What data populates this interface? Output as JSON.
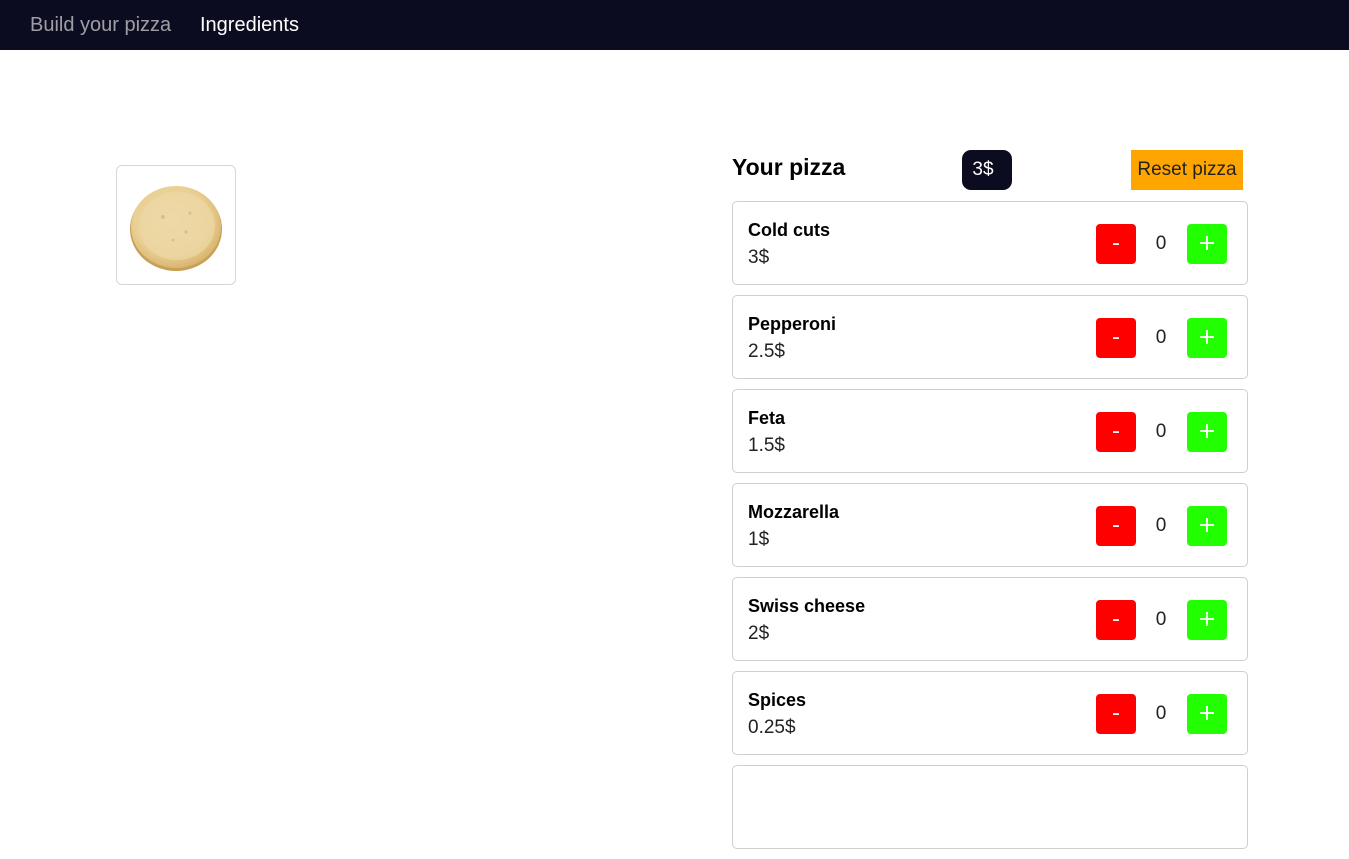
{
  "nav": {
    "items": [
      {
        "label": "Build your pizza"
      },
      {
        "label": "Ingredients"
      }
    ]
  },
  "summary": {
    "title": "Your pizza",
    "total": "3$",
    "reset_label": "Reset pizza"
  },
  "ingredients": [
    {
      "name": "Cold cuts",
      "price": "3$",
      "qty": "0",
      "minus": "-",
      "plus": "+"
    },
    {
      "name": "Pepperoni",
      "price": "2.5$",
      "qty": "0",
      "minus": "-",
      "plus": "+"
    },
    {
      "name": "Feta",
      "price": "1.5$",
      "qty": "0",
      "minus": "-",
      "plus": "+"
    },
    {
      "name": "Mozzarella",
      "price": "1$",
      "qty": "0",
      "minus": "-",
      "plus": "+"
    },
    {
      "name": "Swiss cheese",
      "price": "2$",
      "qty": "0",
      "minus": "-",
      "plus": "+"
    },
    {
      "name": "Spices",
      "price": "0.25$",
      "qty": "0",
      "minus": "-",
      "plus": "+"
    }
  ],
  "colors": {
    "navbar": "#0b0c1f",
    "reset": "#ffa500",
    "minus": "#ff0000",
    "plus": "#22ff00"
  },
  "icons": {
    "pizza_base": "pizza-base-icon"
  }
}
